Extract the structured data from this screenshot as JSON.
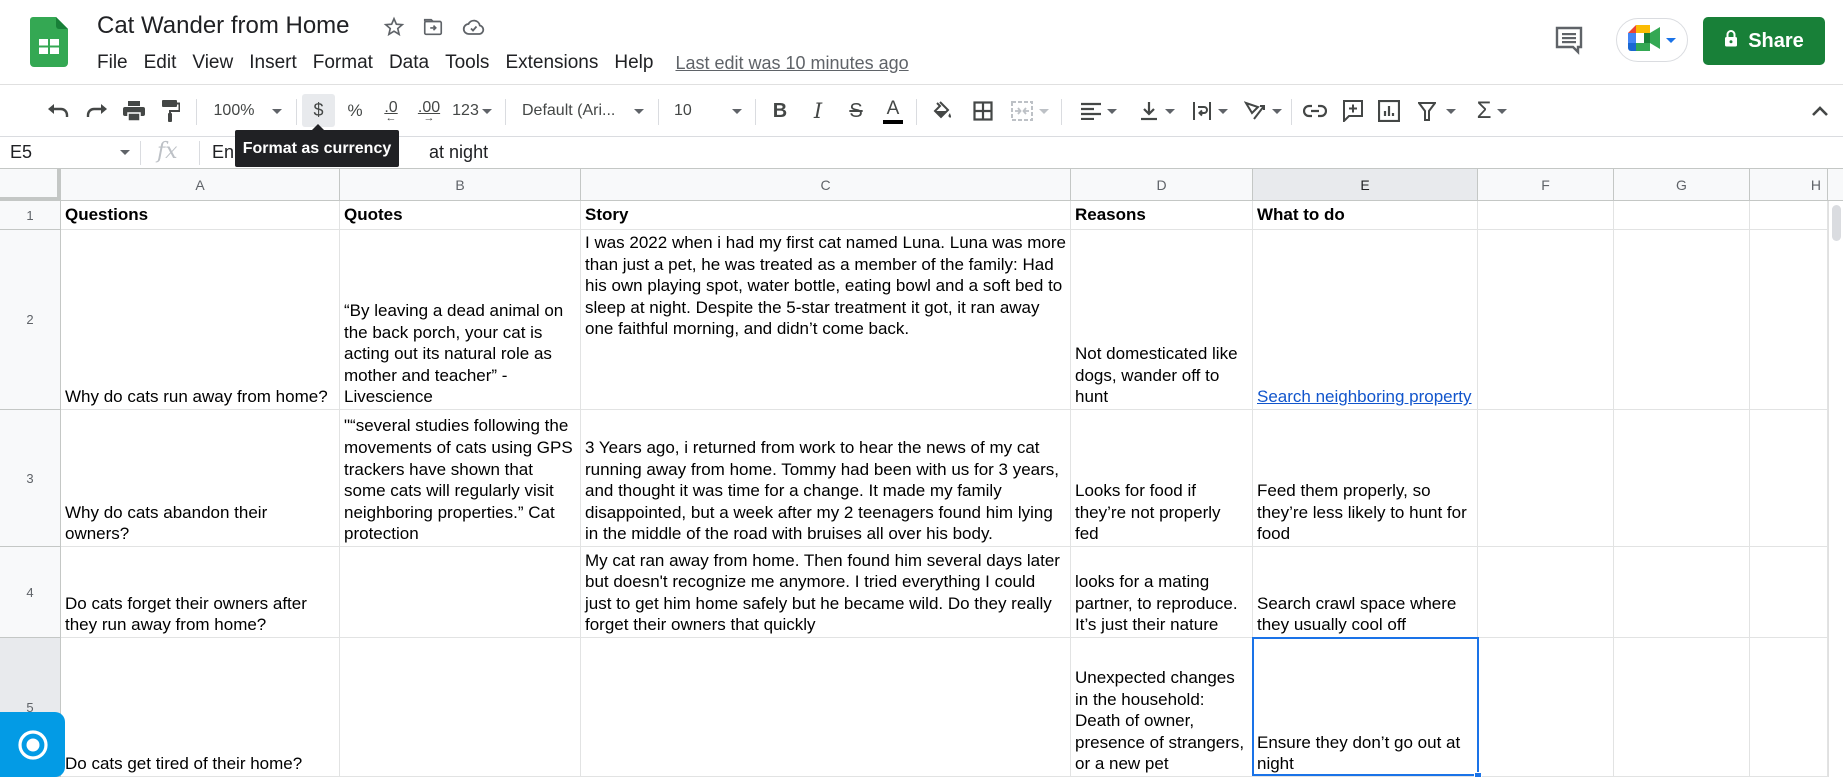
{
  "app": {
    "title": "Cat Wander from Home",
    "menu": [
      "File",
      "Edit",
      "View",
      "Insert",
      "Format",
      "Data",
      "Tools",
      "Extensions",
      "Help"
    ],
    "last_edit": "Last edit was 10 minutes ago",
    "share_label": "Share",
    "brand_color": "#188038"
  },
  "toolbar": {
    "zoom": "100%",
    "currency": "$",
    "percent": "%",
    "decrease_decimal": ".0",
    "increase_decimal": ".00",
    "more_formats": "123",
    "font": "Default (Ari...",
    "font_size": "10",
    "tooltip": "Format as currency"
  },
  "formula_bar": {
    "cell_ref": "E5",
    "fx": "fx",
    "value": "Ensure they don’t go out at night",
    "value_visible_prefix": "En",
    "value_visible_suffix": "at night"
  },
  "sheet": {
    "columns": [
      "A",
      "B",
      "C",
      "D",
      "E",
      "F",
      "G",
      "H"
    ],
    "selected_column": "E",
    "rows": [
      "1",
      "2",
      "3",
      "4",
      "5"
    ],
    "selected_row": "5",
    "header": [
      "Questions",
      "Quotes",
      "Story",
      "Reasons",
      "What to do"
    ],
    "data": [
      {
        "questions": "Why do cats run away from home?",
        "quotes": "“By leaving a dead animal on the back porch, your cat is acting out its natural role as mother and teacher” - Livescience",
        "story": "I was 2022 when i had my first cat named Luna. Luna was more than just a pet, he was treated as a member of the family: Had his own playing spot, water bottle, eating bowl and a soft bed to sleep at night. Despite the 5-star treatment it got, it ran away one faithful morning, and didn’t come back.",
        "reasons": "Not domesticated like dogs, wander off to hunt",
        "what_to_do": "Search neighboring property"
      },
      {
        "questions": "Why do cats abandon their owners?",
        "quotes": "\"“several studies following the movements of cats using GPS trackers have shown that some cats will regularly visit neighboring properties.” Cat protection",
        "story": "3 Years ago, i returned from work to hear the news of my cat running away from home. Tommy had been with us for 3 years, and thought it was time for a change. It made my family disappointed, but a week after my 2 teenagers found him lying in the middle of the road with bruises all over his body.",
        "reasons": "Looks for food if they’re not properly fed",
        "what_to_do": "Feed them properly, so they’re less likely to hunt for food"
      },
      {
        "questions": "Do cats forget their owners after they run away from home?",
        "quotes": "",
        "story": "My cat ran away from home. Then found him several days later but doesn't recognize me anymore. I tried everything I could just to get him home safely but he became wild. Do they really forget their owners that quickly",
        "reasons": "looks for a mating partner, to reproduce. It’s just their nature",
        "what_to_do": "Search crawl space where they usually cool off"
      },
      {
        "questions": "Do cats get tired of their home?",
        "quotes": "",
        "story": "",
        "reasons": "Unexpected changes in the household: Death of owner, presence of strangers, or a new pet",
        "what_to_do": "Ensure they don’t go out at night"
      }
    ]
  }
}
